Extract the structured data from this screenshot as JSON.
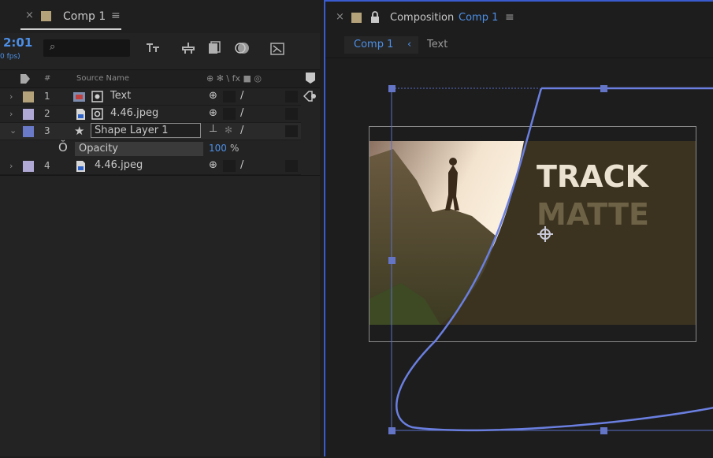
{
  "timeline_panel": {
    "tab": {
      "close": "×",
      "label": "Comp 1",
      "menu": "≡",
      "label_color": "#b4a37a"
    },
    "timecode": "2:01",
    "fps": "0 fps)",
    "search": {
      "icon": "⌕"
    },
    "tools": [
      "flowchart-icon",
      "solo-icon",
      "frame-blend-icon",
      "motion-blur-icon",
      "graph-editor-icon"
    ],
    "header": {
      "hash": "#",
      "source_name": "Source Name",
      "switches": "⊕ ✻ \\ fx ■ ◎"
    },
    "layers": [
      {
        "expand": "›",
        "color": "#b4a37a",
        "num": "1",
        "type_icon": "text-layer-icon",
        "name": "Text"
      },
      {
        "expand": "›",
        "color": "#b0a9d6",
        "num": "2",
        "type_icon": "image-icon",
        "name": "4.46.jpeg"
      },
      {
        "expand": "⌄",
        "color": "#6a79c8",
        "num": "3",
        "type_icon": "star-icon",
        "name": "Shape Layer 1"
      },
      {
        "expand": "›",
        "color": "#b0a9d6",
        "num": "4",
        "type_icon": "image-icon",
        "name": "4.46.jpeg"
      }
    ],
    "opacity": {
      "label": "Opacity",
      "value": "100",
      "unit": "%"
    }
  },
  "composition_panel": {
    "close": "×",
    "title_prefix": "Composition",
    "title_comp": "Comp 1",
    "menu": "≡",
    "breadcrumbs": {
      "active": "Comp 1",
      "sep": "‹",
      "next": "Text"
    },
    "canvas_text": {
      "line1": "TRACK",
      "line2": "MATTE"
    }
  }
}
